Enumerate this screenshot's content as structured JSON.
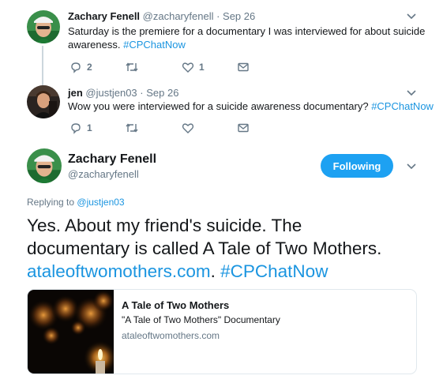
{
  "tweet1": {
    "name": "Zachary Fenell",
    "handle": "@zacharyfenell",
    "time": "· Sep 26",
    "text_line1": "Saturday is the premiere for a documentary I was interviewed for about suicide",
    "text_line2": "awareness.",
    "hashtag": "#CPChatNow",
    "reply_count": "2",
    "retweet_count": "",
    "like_count": "1"
  },
  "tweet2": {
    "name": "jen",
    "handle": "@justjen03",
    "time": "· Sep 26",
    "text": "Wow you were interviewed for a suicide awareness documentary?",
    "hashtag": "#CPChatNow",
    "reply_count": "1",
    "retweet_count": "",
    "like_count": ""
  },
  "main": {
    "name": "Zachary Fenell",
    "handle": "@zacharyfenell",
    "follow_label": "Following",
    "replying_prefix": "Replying to",
    "replying_handle": "@justjen03",
    "text_line1": "Yes. About my friend's suicide. The",
    "text_line2": "documentary is called A Tale of Two Mothers.",
    "link": "ataleoftwomothers.com",
    "link_suffix": ".",
    "hashtag": "#CPChatNow"
  },
  "card": {
    "title": "A Tale of Two Mothers",
    "description": "\"A Tale of Two Mothers\" Documentary",
    "domain": "ataleoftwomothers.com"
  },
  "colors": {
    "accent": "#1da1f2",
    "link": "#1b95e0",
    "muted": "#657786"
  },
  "icons": [
    "reply-icon",
    "retweet-icon",
    "like-icon",
    "dm-icon",
    "chevron-down-icon"
  ]
}
